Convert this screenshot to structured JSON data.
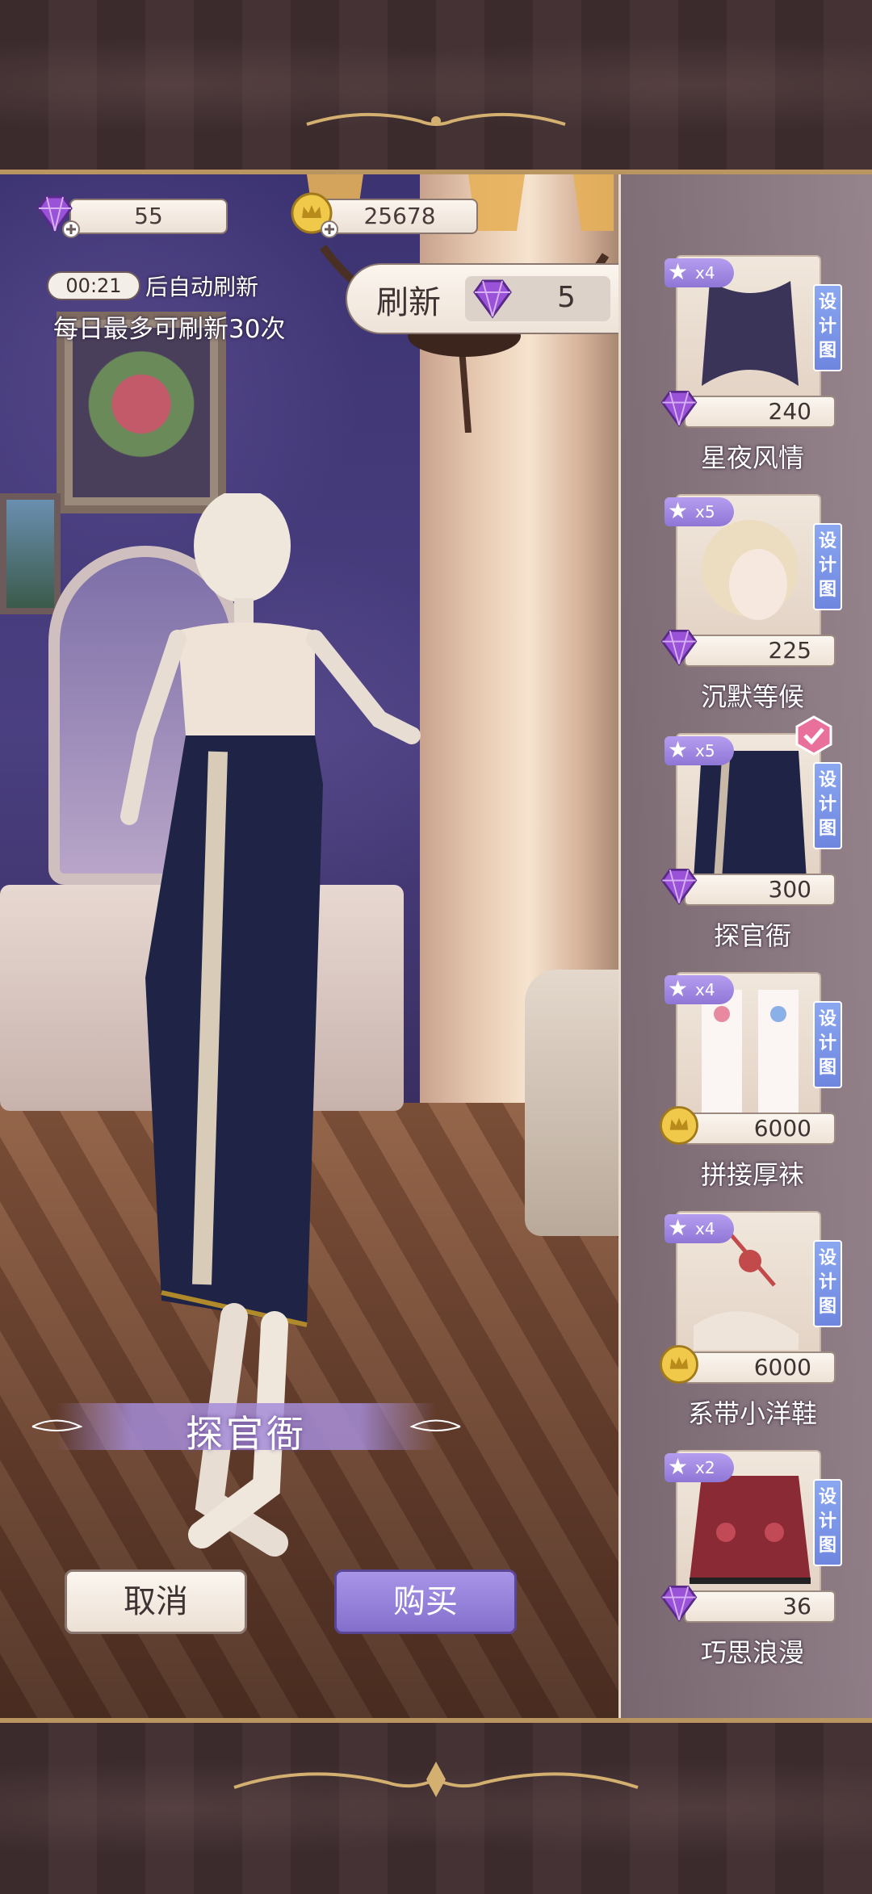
{
  "currency": {
    "diamonds": "55",
    "gold": "25678"
  },
  "refresh": {
    "timer": "00:21",
    "auto_refresh_text": "后自动刷新",
    "daily_limit_text": "每日最多可刷新30次",
    "button_label": "刷新",
    "cost": "5"
  },
  "preview": {
    "item_name": "探官衙"
  },
  "buttons": {
    "cancel": "取消",
    "buy": "购买"
  },
  "design_tag_chars": [
    "设",
    "计",
    "图"
  ],
  "items": [
    {
      "name": "星夜风情",
      "stars": "x4",
      "price": "240",
      "currency": "diamond",
      "selected": false
    },
    {
      "name": "沉默等候",
      "stars": "x5",
      "price": "225",
      "currency": "diamond",
      "selected": false
    },
    {
      "name": "探官衙",
      "stars": "x5",
      "price": "300",
      "currency": "diamond",
      "selected": true
    },
    {
      "name": "拼接厚袜",
      "stars": "x4",
      "price": "6000",
      "currency": "gold",
      "selected": false
    },
    {
      "name": "系带小洋鞋",
      "stars": "x4",
      "price": "6000",
      "currency": "gold",
      "selected": false
    },
    {
      "name": "巧思浪漫",
      "stars": "x2",
      "price": "36",
      "currency": "diamond",
      "selected": false
    }
  ],
  "colors": {
    "accent_purple": "#8f76d6",
    "frame_gold": "#b99660",
    "design_blue": "#6f86e0"
  }
}
